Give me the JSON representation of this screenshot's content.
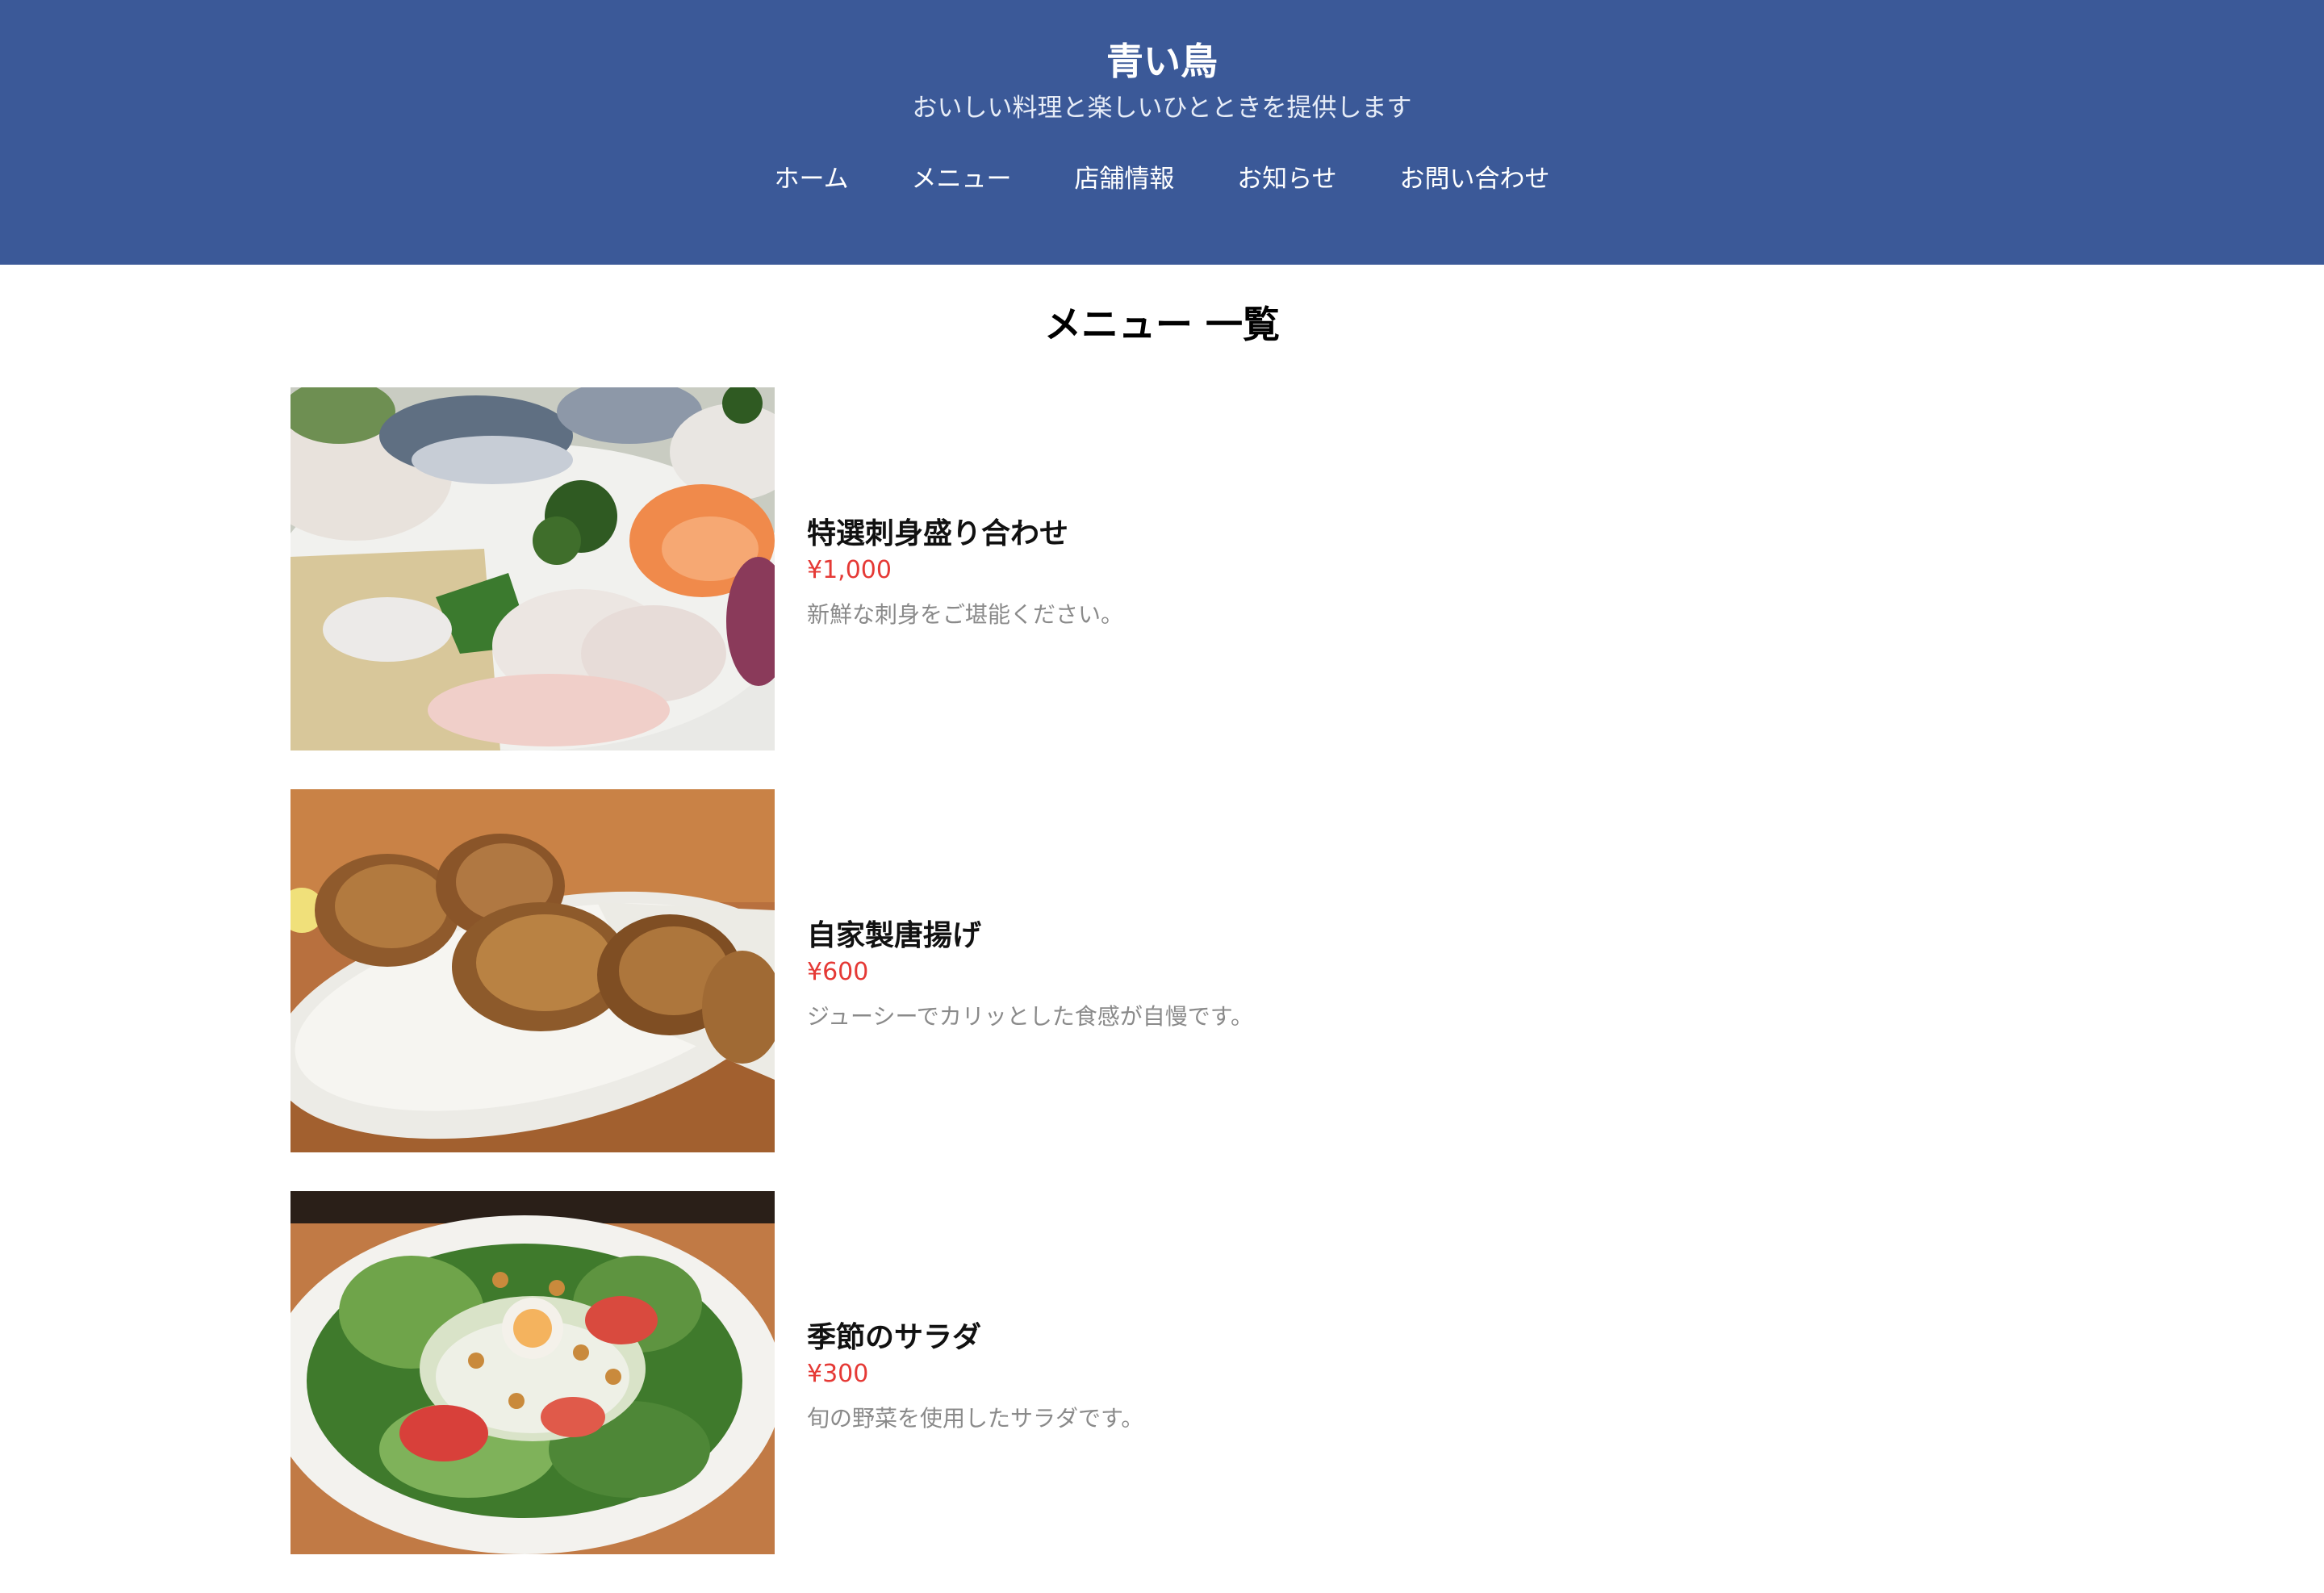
{
  "header": {
    "title": "青い鳥",
    "tagline": "おいしい料理と楽しいひとときを提供します",
    "nav": [
      {
        "label": "ホーム"
      },
      {
        "label": "メニュー"
      },
      {
        "label": "店舗情報"
      },
      {
        "label": "お知らせ"
      },
      {
        "label": "お問い合わせ"
      }
    ],
    "background_color": "#3b5998"
  },
  "main": {
    "title": "メニュー 一覧",
    "items": [
      {
        "name": "特選刺身盛り合わせ",
        "price": "¥1,000",
        "description": "新鮮な刺身をご堪能ください。"
      },
      {
        "name": "自家製唐揚げ",
        "price": "¥600",
        "description": "ジューシーでカリッとした食感が自慢です。"
      },
      {
        "name": "季節のサラダ",
        "price": "¥300",
        "description": "旬の野菜を使用したサラダです。"
      }
    ],
    "price_color": "#e53935"
  }
}
